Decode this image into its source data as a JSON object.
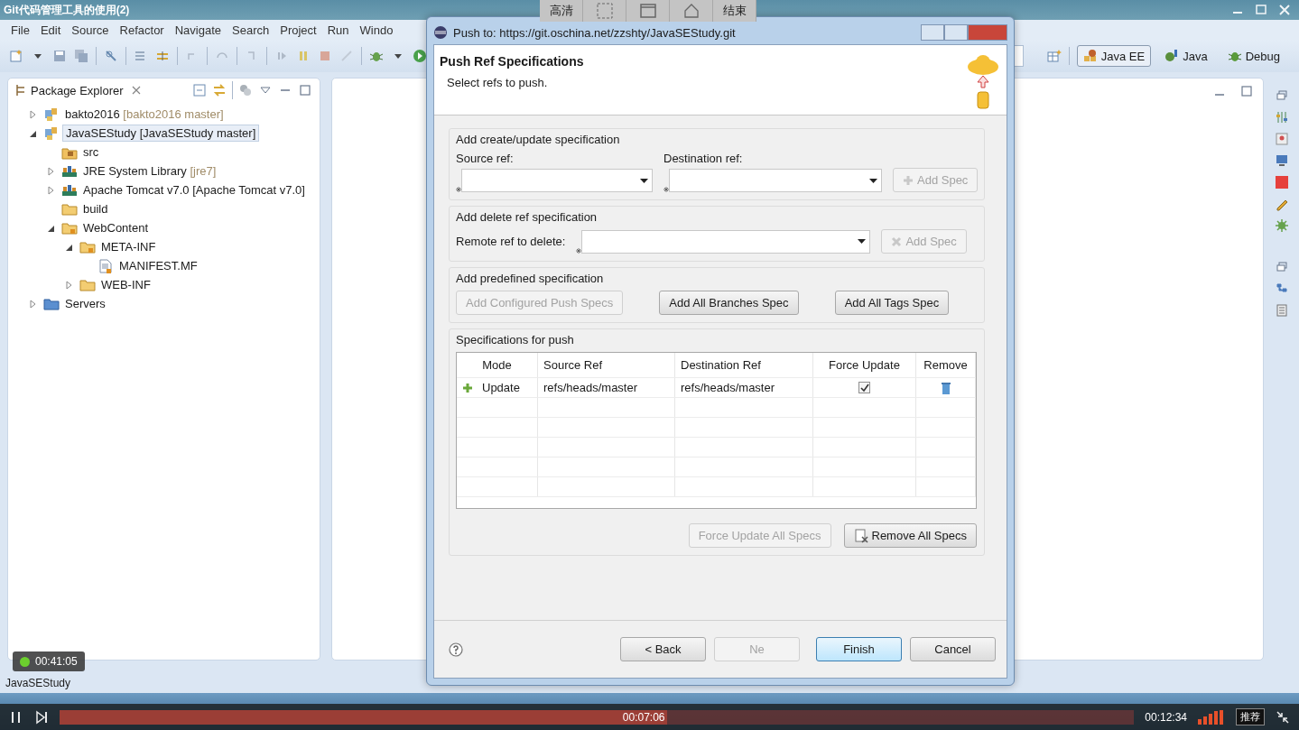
{
  "video_title": "Git代码管理工具的使用(2)",
  "recorder_toolbar": [
    {
      "kind": "text",
      "label": "高清"
    },
    {
      "kind": "region"
    },
    {
      "kind": "window"
    },
    {
      "kind": "home"
    },
    {
      "kind": "text",
      "label": "结束"
    }
  ],
  "menu": [
    "File",
    "Edit",
    "Source",
    "Refactor",
    "Navigate",
    "Search",
    "Project",
    "Run",
    "Windo"
  ],
  "perspectives": [
    {
      "kind": "javaee",
      "label": "Java EE",
      "selected": true
    },
    {
      "kind": "java",
      "label": "Java",
      "selected": false
    },
    {
      "kind": "debug",
      "label": "Debug",
      "selected": false
    }
  ],
  "package_explorer": {
    "title": "Package Explorer",
    "tree": [
      {
        "kind": "project",
        "name": "bakto2016",
        "decoration": "[bakto2016 master]",
        "dim": true,
        "expanded": false,
        "selected": false
      },
      {
        "kind": "project",
        "name": "JavaSEStudy",
        "decoration": "[JavaSEStudy master]",
        "dim": false,
        "expanded": true,
        "selected": true,
        "children": [
          {
            "kind": "source",
            "name": "src",
            "selected": false
          },
          {
            "kind": "library",
            "name": "JRE System Library",
            "decoration": "[jre7]",
            "dim": true,
            "expanded": false,
            "selected": false
          },
          {
            "kind": "library",
            "name": "Apache Tomcat v7.0",
            "decoration": "[Apache Tomcat v7.0]",
            "dim": false,
            "expanded": false,
            "selected": false
          },
          {
            "kind": "folder",
            "name": "build",
            "selected": false
          },
          {
            "kind": "webfolder",
            "name": "WebContent",
            "expanded": true,
            "selected": false,
            "children": [
              {
                "kind": "webfolder",
                "name": "META-INF",
                "expanded": true,
                "selected": false,
                "children": [
                  {
                    "kind": "file",
                    "name": "MANIFEST.MF",
                    "selected": false
                  }
                ]
              },
              {
                "kind": "folder",
                "name": "WEB-INF",
                "expanded": false,
                "selected": false
              }
            ]
          }
        ]
      },
      {
        "kind": "servers",
        "name": "Servers",
        "expanded": false,
        "selected": false
      }
    ]
  },
  "status_bar": "JavaSEStudy",
  "dialog": {
    "title": "Push to: https://git.oschina.net/zzshty/JavaSEStudy.git",
    "heading": "Push Ref Specifications",
    "description": "Select refs to push.",
    "create_group": {
      "title": "Add create/update specification",
      "source_label": "Source ref:",
      "destination_label": "Destination ref:",
      "add_button": {
        "label": "Add Spec",
        "disabled": true
      }
    },
    "delete_group": {
      "title": "Add delete ref specification",
      "remote_label": "Remote ref to delete:",
      "add_button": {
        "label": "Add Spec",
        "disabled": true
      }
    },
    "predefined_group": {
      "title": "Add predefined specification",
      "buttons": [
        {
          "label": "Add Configured Push Specs",
          "disabled": true
        },
        {
          "label": "Add All Branches Spec",
          "disabled": false
        },
        {
          "label": "Add All Tags Spec",
          "disabled": false
        }
      ]
    },
    "specs_group": {
      "title": "Specifications for push",
      "columns": [
        "Mode",
        "Source Ref",
        "Destination Ref",
        "Force Update",
        "Remove"
      ],
      "rows": [
        {
          "mode": "Update",
          "source": "refs/heads/master",
          "destination": "refs/heads/master",
          "force_update": true
        }
      ],
      "buttons": [
        {
          "kind": "force",
          "label": "Force Update All Specs",
          "disabled": true
        },
        {
          "kind": "remove",
          "label": "Remove All Specs",
          "disabled": false
        }
      ]
    },
    "footer_buttons": [
      {
        "label": "< Back",
        "disabled": false,
        "default": false
      },
      {
        "label": "Ne",
        "disabled": true,
        "default": false
      },
      {
        "label": "Finish",
        "disabled": false,
        "default": true
      },
      {
        "label": "Cancel",
        "disabled": false,
        "default": false
      }
    ]
  },
  "player": {
    "elapsed_badge": "00:41:05",
    "position": "00:07:06",
    "duration": "00:12:34",
    "level": 0.565,
    "recommend": "推荐"
  }
}
